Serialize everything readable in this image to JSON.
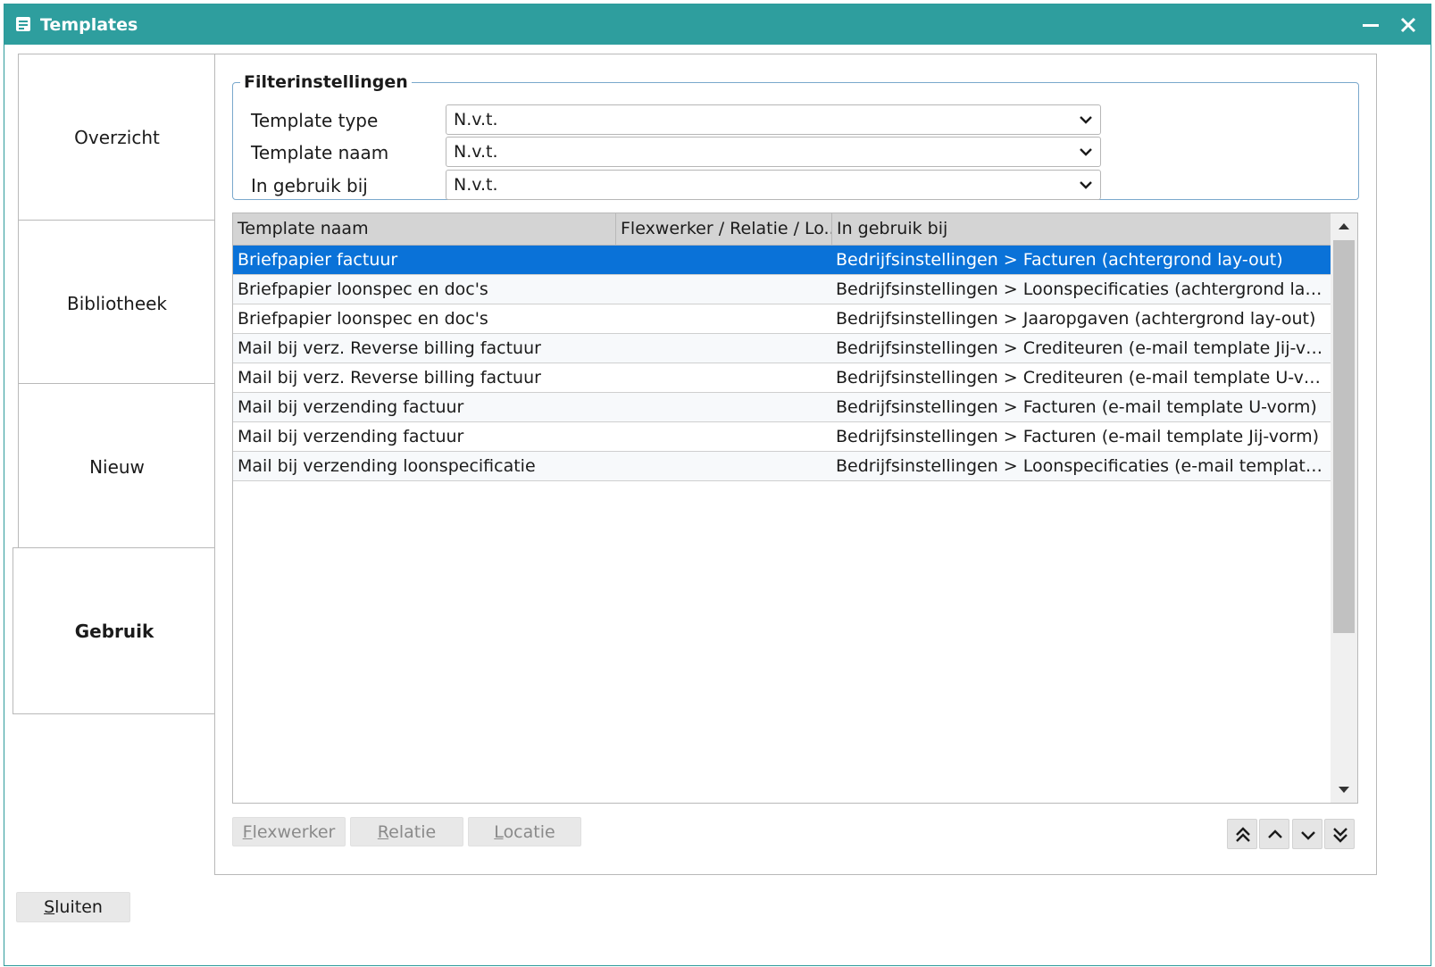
{
  "window": {
    "title": "Templates",
    "title_icon": "templates-app-icon",
    "accent_color": "#2e9e9e"
  },
  "sidebar": {
    "items": [
      {
        "label": "Overzicht"
      },
      {
        "label": "Bibliotheek"
      },
      {
        "label": "Nieuw"
      },
      {
        "label": "Gebruik"
      }
    ],
    "active": "Gebruik"
  },
  "filter": {
    "legend": "Filterinstellingen",
    "fields": [
      {
        "label": "Template type",
        "value": "N.v.t."
      },
      {
        "label": "Template naam",
        "value": "N.v.t."
      },
      {
        "label": "In gebruik bij",
        "value": "N.v.t."
      }
    ]
  },
  "table": {
    "columns": [
      "Template naam",
      "Flexwerker / Relatie / Lo...",
      "In gebruik bij"
    ],
    "rows": [
      [
        "Briefpapier factuur",
        "",
        "Bedrijfsinstellingen > Facturen (achtergrond lay-out)"
      ],
      [
        "Briefpapier loonspec en doc's",
        "",
        "Bedrijfsinstellingen > Loonspecificaties (achtergrond lay-out)"
      ],
      [
        "Briefpapier loonspec en doc's",
        "",
        "Bedrijfsinstellingen > Jaaropgaven (achtergrond lay-out)"
      ],
      [
        "Mail bij verz. Reverse billing factuur",
        "",
        "Bedrijfsinstellingen > Crediteuren (e-mail template Jij-vorm)"
      ],
      [
        "Mail bij verz. Reverse billing factuur",
        "",
        "Bedrijfsinstellingen > Crediteuren (e-mail template U-vorm)"
      ],
      [
        "Mail bij verzending factuur",
        "",
        "Bedrijfsinstellingen > Facturen (e-mail template U-vorm)"
      ],
      [
        "Mail bij verzending factuur",
        "",
        "Bedrijfsinstellingen > Facturen (e-mail template Jij-vorm)"
      ],
      [
        "Mail bij verzending loonspecificatie",
        "",
        "Bedrijfsinstellingen > Loonspecificaties (e-mail template Jij-v..."
      ]
    ],
    "selected_row": 0,
    "selection_color": "#0a72d8"
  },
  "buttons": {
    "flexwerker": {
      "accel": "F",
      "rest": "lexwerker"
    },
    "relatie": {
      "accel": "R",
      "rest": "elatie"
    },
    "locatie": {
      "accel": "L",
      "rest": "ocatie"
    },
    "sluiten": {
      "accel": "S",
      "rest": "luiten"
    }
  },
  "nav_icons": [
    "move-to-top-icon",
    "move-up-icon",
    "move-down-icon",
    "move-to-bottom-icon"
  ]
}
